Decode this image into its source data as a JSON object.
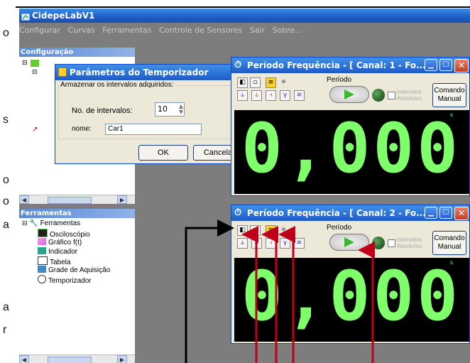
{
  "side_fragments": [
    "o",
    "s",
    "o",
    "o",
    "a",
    "a",
    "r"
  ],
  "app": {
    "title": "CidepeLabV1",
    "menu": [
      "Configurar",
      "Curvas",
      "Ferramentas",
      "Controle de Sensores",
      "Sair",
      "Sobre..."
    ]
  },
  "config_panel": {
    "title": "Configuração"
  },
  "tools_panel": {
    "title": "Ferramentas",
    "root": "Ferramentas",
    "items": [
      "Osciloscópio",
      "Gráfico f(t)",
      "Indicador",
      "Tabela",
      "Grade de Aquisição",
      "Temporizador"
    ]
  },
  "dialog": {
    "title": "Parâmetros do Temporizador",
    "group_label": "Armazenar os intervalos adquiridos:",
    "intervals_label": "No. de intervalos:",
    "intervals_value": "10",
    "name_label": "nome:",
    "name_value": "Car1",
    "ok": "OK",
    "cancel": "Cancela"
  },
  "windows": [
    {
      "title": "Período Frequência - [ Canal: 1 - Fo...",
      "mode": "Período",
      "abs_label_1": "Intervalos",
      "abs_label_2": "Absolutos",
      "manual_1": "Comando",
      "manual_2": "Manual",
      "value": "0,000",
      "unit": "s"
    },
    {
      "title": "Período Frequência - [ Canal: 2 - Fo...",
      "mode": "Período",
      "abs_label_1": "Intervalos",
      "abs_label_2": "Absolutos",
      "manual_1": "Comando",
      "manual_2": "Manual",
      "value": "0,000",
      "unit": "s"
    }
  ],
  "colors": {
    "digit": "#7fff6a",
    "title_blue": "#1d5fc7",
    "arrow_red": "#c0001a",
    "desktop": "#7d7d7d"
  }
}
